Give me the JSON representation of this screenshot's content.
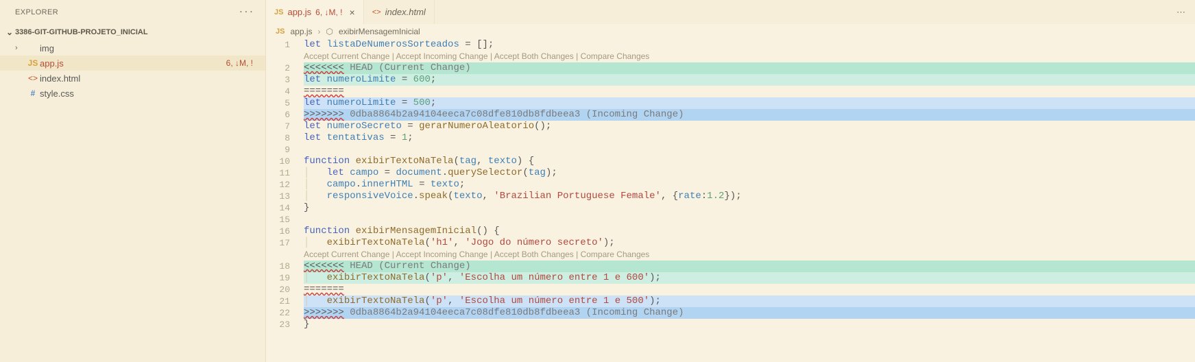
{
  "sidebar": {
    "title": "EXPLORER",
    "section": "3386-GIT-GITHUB-PROJETO_INICIAL",
    "items": [
      {
        "label": "img",
        "icon": "folder",
        "status": ""
      },
      {
        "label": "app.js",
        "icon": "js",
        "status": "6, ↓M, !"
      },
      {
        "label": "index.html",
        "icon": "html",
        "status": ""
      },
      {
        "label": "style.css",
        "icon": "css",
        "status": ""
      }
    ]
  },
  "tabs": [
    {
      "label": "app.js",
      "status": "6, ↓M, !",
      "icon": "js",
      "active": true
    },
    {
      "label": "index.html",
      "status": "",
      "icon": "html",
      "active": false
    }
  ],
  "breadcrumb": {
    "file": "app.js",
    "symbol": "exibirMensagemInicial"
  },
  "codelens": "Accept Current Change | Accept Incoming Change | Accept Both Changes | Compare Changes",
  "code": {
    "l1": "let listaDeNumerosSorteados = [];",
    "l2": "<<<<<<< HEAD (Current Change)",
    "l3": "let numeroLimite = 600;",
    "l4": "=======",
    "l5": "let numeroLimite = 500;",
    "l6": ">>>>>>> 0dba8864b2a94104eeca7c08dfe810db8fdbeea3 (Incoming Change)",
    "l7": "let numeroSecreto = gerarNumeroAleatorio();",
    "l8": "let tentativas = 1;",
    "l10": "function exibirTextoNaTela(tag, texto) {",
    "l11": "    let campo = document.querySelector(tag);",
    "l12": "    campo.innerHTML = texto;",
    "l13": "    responsiveVoice.speak(texto, 'Brazilian Portuguese Female', {rate:1.2});",
    "l14": "}",
    "l16": "function exibirMensagemInicial() {",
    "l17": "    exibirTextoNaTela('h1', 'Jogo do número secreto');",
    "l18": "<<<<<<< HEAD (Current Change)",
    "l19": "    exibirTextoNaTela('p', 'Escolha um número entre 1 e 600');",
    "l20": "=======",
    "l21": "    exibirTextoNaTela('p', 'Escolha um número entre 1 e 500');",
    "l22": ">>>>>>> 0dba8864b2a94104eeca7c08dfe810db8fdbeea3 (Incoming Change)",
    "l23": "}"
  },
  "lines": [
    "1",
    "2",
    "3",
    "4",
    "5",
    "6",
    "7",
    "8",
    "9",
    "10",
    "11",
    "12",
    "13",
    "14",
    "15",
    "16",
    "17",
    "18",
    "19",
    "20",
    "21",
    "22",
    "23"
  ]
}
